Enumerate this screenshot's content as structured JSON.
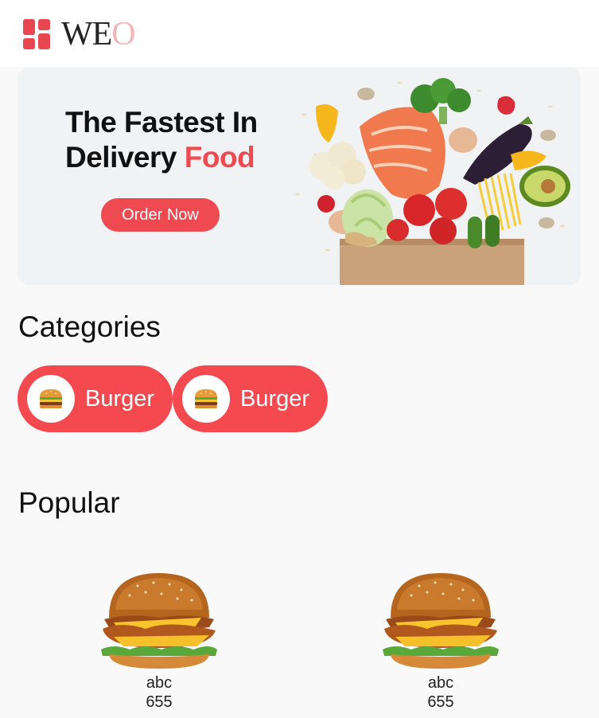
{
  "header": {
    "logo_text_main": "WE",
    "logo_text_end": "O"
  },
  "banner": {
    "title_line1": "The Fastest In",
    "title_line2_prefix": "Delivery ",
    "title_line2_accent": "Food",
    "order_button_label": "Order Now"
  },
  "categories": {
    "title": "Categories",
    "items": [
      {
        "label": "Burger",
        "icon": "burger-icon"
      },
      {
        "label": "Burger",
        "icon": "burger-icon"
      }
    ]
  },
  "popular": {
    "title": "Popular",
    "items": [
      {
        "name": "abc",
        "price": "655"
      },
      {
        "name": "abc",
        "price": "655"
      }
    ]
  },
  "colors": {
    "accent": "#ef4a52",
    "background": "#f9f9f9"
  }
}
